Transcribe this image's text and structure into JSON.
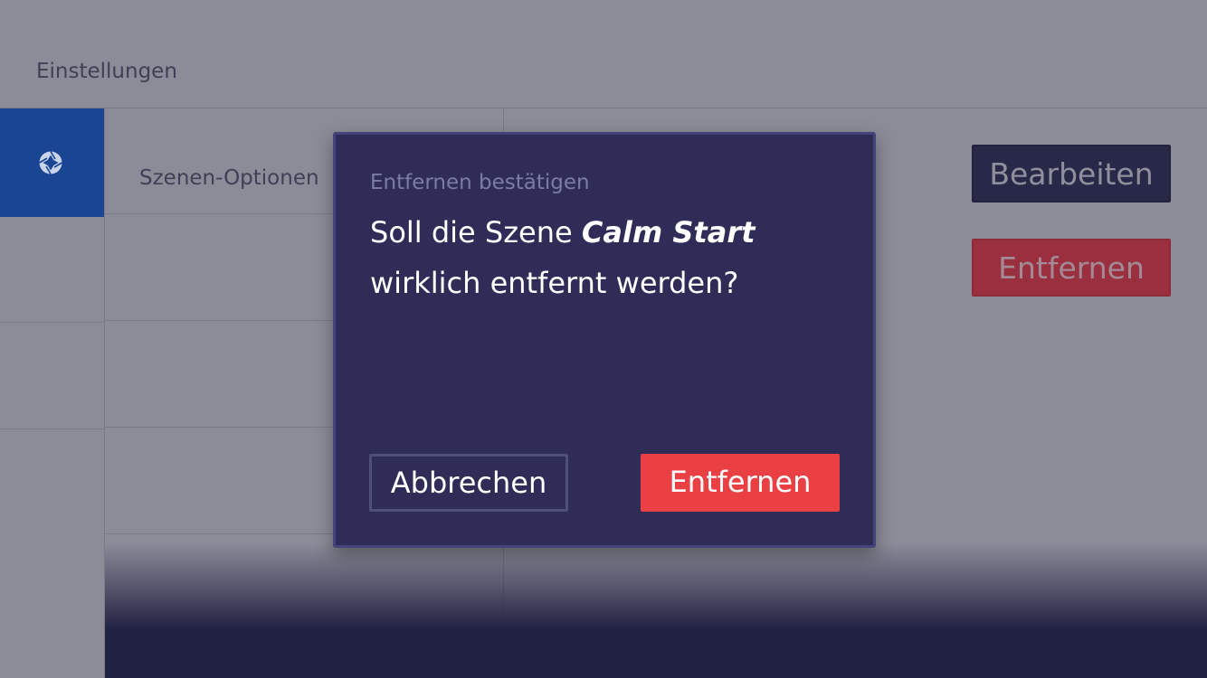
{
  "header": {
    "title": "Einstellungen"
  },
  "sidebar": {
    "active_icon": "aperture-icon"
  },
  "list": {
    "first_item_label": "Szenen-Optionen"
  },
  "actions": {
    "edit_label": "Bearbeiten",
    "remove_label": "Entfernen"
  },
  "dialog": {
    "caption": "Entfernen bestätigen",
    "message_prefix": "Soll die Szene ",
    "scene_name": "Calm Start",
    "message_suffix": "wirklich entfernt werden?",
    "cancel_label": "Abbrechen",
    "confirm_label": "Entfernen"
  },
  "colors": {
    "sidebar_active": "#1a4592",
    "dialog_background": "#2f2d57",
    "confirm_button": "#eb4043",
    "backdrop": "#8c8c99"
  }
}
